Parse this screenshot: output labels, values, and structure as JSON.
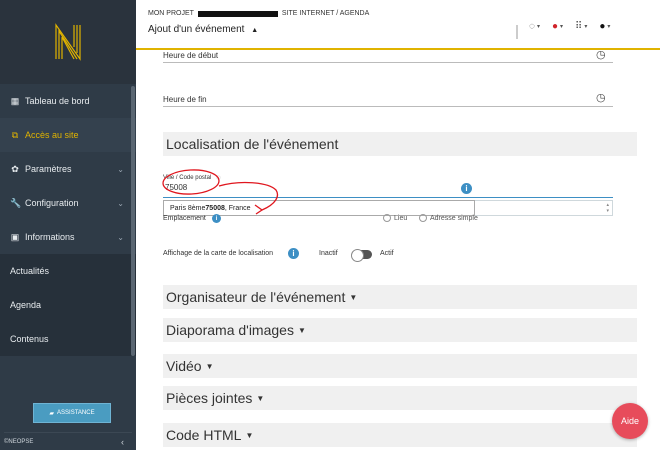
{
  "sidebar": {
    "items": [
      {
        "label": "Tableau de bord",
        "icon": "dashboard-icon"
      },
      {
        "label": "Accès au site",
        "icon": "external-link-icon"
      },
      {
        "label": "Paramètres",
        "icon": "gear-icon"
      },
      {
        "label": "Configuration",
        "icon": "wrench-icon"
      },
      {
        "label": "Informations",
        "icon": "calendar-icon"
      },
      {
        "label": "Actualités"
      },
      {
        "label": "Agenda"
      },
      {
        "label": "Contenus"
      }
    ],
    "assistance_label": "ASSISTANCE",
    "copyright": "©NEOPSE"
  },
  "header": {
    "breadcrumb_start": "MON PROJET",
    "breadcrumb_end": "SITE INTERNET / AGENDA",
    "page_title": "Ajout d'un événement"
  },
  "form": {
    "heure_debut_label": "Heure de début",
    "heure_fin_label": "Heure de fin",
    "localisation_title": "Localisation de l'événement",
    "ville_label": "Ville / Code postal",
    "ville_value": "75008",
    "suggestion_prefix": "Paris 8ème ",
    "suggestion_bold": "75008",
    "suggestion_suffix": ", France",
    "emplacement_label": "Emplacement",
    "option_lieu": "Lieu",
    "option_adresse": "Adresse simple",
    "carte_label": "Affichage de la carte de localisation",
    "inactif": "Inactif",
    "actif": "Actif"
  },
  "sections": [
    {
      "label": "Organisateur de l'événement"
    },
    {
      "label": "Diaporama d'images"
    },
    {
      "label": "Vidéo"
    },
    {
      "label": "Pièces jointes"
    },
    {
      "label": "Code HTML"
    }
  ],
  "aide_label": "Aide",
  "colors": {
    "accent": "#e0b300",
    "sidebar": "#2f3b47",
    "info": "#3d8fc4",
    "aide": "#e74c5b",
    "annotation": "#e0161e"
  }
}
